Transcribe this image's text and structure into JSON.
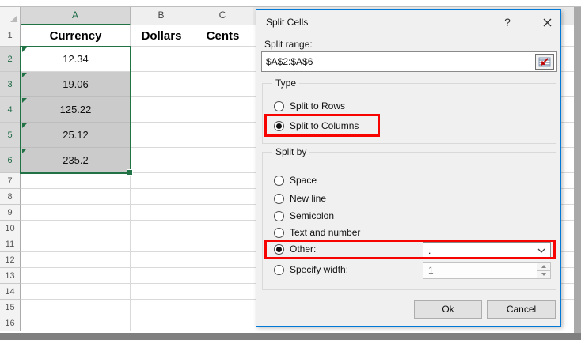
{
  "sheet": {
    "column_headers": [
      "A",
      "B",
      "C"
    ],
    "selected_column": "A",
    "row_labels": [
      "1",
      "2",
      "3",
      "4",
      "5",
      "6",
      "7",
      "8",
      "9",
      "10",
      "11",
      "12",
      "13",
      "14",
      "15",
      "16"
    ],
    "selected_rows": [
      "2",
      "3",
      "4",
      "5",
      "6"
    ],
    "cells": {
      "A1": "Currency",
      "B1": "Dollars",
      "C1": "Cents"
    },
    "column_a_values": [
      "12.34",
      "19.06",
      "125.22",
      "25.12",
      "235.2"
    ]
  },
  "dialog": {
    "title": "Split Cells",
    "help_label": "?",
    "split_range_label": "Split range:",
    "split_range_value": "$A$2:$A$6",
    "type_group": {
      "label": "Type",
      "options": [
        {
          "label": "Split to Rows",
          "selected": false,
          "highlighted": false
        },
        {
          "label": "Split to Columns",
          "selected": true,
          "highlighted": true
        }
      ]
    },
    "split_by_group": {
      "label": "Split by",
      "options": [
        {
          "label": "Space",
          "selected": false
        },
        {
          "label": "New line",
          "selected": false
        },
        {
          "label": "Semicolon",
          "selected": false
        },
        {
          "label": "Text and number",
          "selected": false
        },
        {
          "label": "Other:",
          "selected": true,
          "highlighted": true
        },
        {
          "label": "Specify width:",
          "selected": false
        }
      ],
      "other_delimiter": ".",
      "specify_width_value": "1"
    },
    "ok_label": "Ok",
    "cancel_label": "Cancel"
  },
  "colors": {
    "excel_green": "#217346",
    "selection_fill": "#CBCBCB",
    "dialog_border": "#0078D7",
    "highlight_red": "#F80400"
  }
}
